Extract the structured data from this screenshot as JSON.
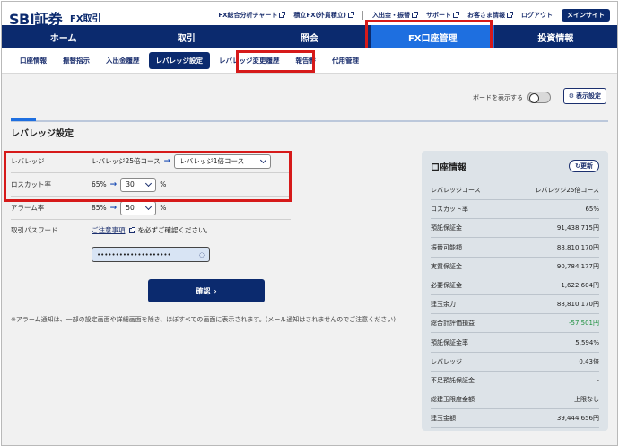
{
  "header": {
    "logo": "SBI証券",
    "product": "FX取引",
    "links": [
      {
        "label": "FX総合分析チャート",
        "external": true
      },
      {
        "label": "積立FX(外貨積立)",
        "external": true
      },
      {
        "label": "入出金・振替",
        "external": true
      },
      {
        "label": "サポート",
        "external": true
      },
      {
        "label": "お客さま情報",
        "external": true
      },
      {
        "label": "ログアウト",
        "external": false
      }
    ],
    "main_site": "メインサイト"
  },
  "nav": {
    "items": [
      "ホーム",
      "取引",
      "照会",
      "FX口座管理",
      "投資情報"
    ],
    "active": "FX口座管理"
  },
  "subnav": {
    "items": [
      "口座情報",
      "振替指示",
      "入出金履歴",
      "レバレッジ設定",
      "レバレッジ変更履歴",
      "報告書",
      "代用管理"
    ],
    "active": "レバレッジ設定"
  },
  "toolbar": {
    "board_label": "ボードを表示する",
    "board_on": false,
    "display_settings": "表示設定"
  },
  "page_title": "レバレッジ設定",
  "form": {
    "leverage": {
      "label": "レバレッジ",
      "current": "レバレッジ25倍コース",
      "selected": "レバレッジ1倍コース"
    },
    "losscut": {
      "label": "ロスカット率",
      "current": "65%",
      "selected": "30",
      "unit": "%"
    },
    "alarm": {
      "label": "アラーム率",
      "current": "85%",
      "selected": "50",
      "unit": "%"
    },
    "password": {
      "label": "取引パスワード",
      "notice_link": "ご注意事項",
      "notice_text": "を必ずご確認ください。",
      "value": "••••••••••••••••••••"
    },
    "confirm": "確認"
  },
  "footnote": "※アラーム通知は、一部の設定画面や詳細画面を除き、ほぼすべての画面に表示されます。(メール通知はされませんのでご注意ください)",
  "account_panel": {
    "title": "口座情報",
    "refresh": "更新",
    "rows": [
      {
        "label": "レバレッジコース",
        "value": "レバレッジ25倍コース"
      },
      {
        "label": "ロスカット率",
        "value": "65%"
      },
      {
        "label": "預託保証金",
        "value": "91,438,715円"
      },
      {
        "label": "振替可能額",
        "value": "88,810,170円"
      },
      {
        "label": "実質保証金",
        "value": "90,784,177円"
      },
      {
        "label": "必要保証金",
        "value": "1,622,604円"
      },
      {
        "label": "建玉余力",
        "value": "88,810,170円"
      },
      {
        "label": "総合計評価損益",
        "value": "-57,501円"
      },
      {
        "label": "預託保証金率",
        "value": "5,594%"
      },
      {
        "label": "レバレッジ",
        "value": "0.43倍"
      },
      {
        "label": "不足預託保証金",
        "value": "-"
      },
      {
        "label": "総建玉限度金額",
        "value": "上限なし"
      },
      {
        "label": "建玉金額",
        "value": "39,444,656円"
      }
    ]
  },
  "colors": {
    "brand": "#0b2a6e",
    "active_nav": "#1e6fe0",
    "highlight": "#d61a1a",
    "negative": "#1a8f3c"
  }
}
